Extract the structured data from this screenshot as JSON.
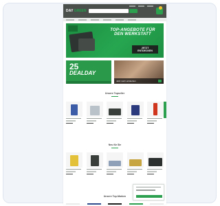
{
  "header": {
    "logo_part1": "DAY",
    "logo_part2": "GREEN",
    "search_placeholder": "",
    "accent_color": "#2ca04e"
  },
  "hero": {
    "title_line1": "TOP-ANGEBOTE FÜR",
    "title_line2": "DEN WERKSTATT",
    "cta_line1": "JETZT",
    "cta_line2": "ENTDECKEN"
  },
  "deal": {
    "number": "25",
    "text": "DEALDAY"
  },
  "promo2": {
    "caption": "Jetzt mehr entdecken"
  },
  "sections": {
    "bestseller_title": "Unsere Topseller",
    "new_title": "Neu für Sie",
    "brands_title": "Unsere Top-Marken"
  },
  "icons": {
    "cart": "cart-icon",
    "search": "search-icon"
  }
}
